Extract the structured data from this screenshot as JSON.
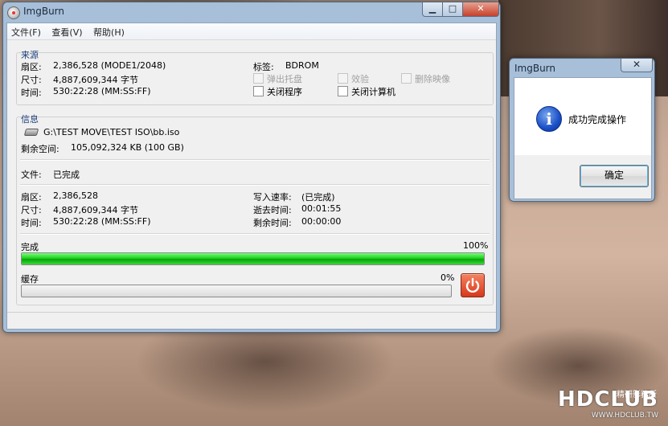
{
  "window": {
    "title": "ImgBurn",
    "min_symbol": "▁",
    "max_symbol": "□",
    "close_symbol": "✕"
  },
  "menu": {
    "file": "文件(F)",
    "view": "查看(V)",
    "help": "帮助(H)"
  },
  "source": {
    "title": "来源",
    "sectors_label": "扇区:",
    "sectors_value": "2,386,528 (MODE1/2048)",
    "size_label": "尺寸:",
    "size_value": "4,887,609,344 字节",
    "time_label": "时间:",
    "time_value": "530:22:28 (MM:SS:FF)",
    "tag_label": "标签:",
    "tag_value": "BDROM",
    "eject_tray": "弹出托盘",
    "verify": "效验",
    "delete_image": "删除映像",
    "close_program": "关闭程序",
    "shutdown_computer": "关闭计算机"
  },
  "info": {
    "title": "信息",
    "path": "G:\\TEST MOVE\\TEST ISO\\bb.iso",
    "free_space_label": "剩余空间:",
    "free_space_value": "105,092,324 KB  (100 GB)",
    "file_label": "文件:",
    "file_value": "已完成",
    "sectors_label": "扇区:",
    "sectors_value": "2,386,528",
    "size_label": "尺寸:",
    "size_value": "4,887,609,344 字节",
    "time_label": "时间:",
    "time_value": "530:22:28 (MM:SS:FF)",
    "write_speed_label": "写入速率:",
    "write_speed_value": "(已完成)",
    "elapsed_label": "逝去时间:",
    "elapsed_value": "00:01:55",
    "remaining_label": "剩余时间:",
    "remaining_value": "00:00:00",
    "complete_label": "完成",
    "complete_percent": "100%",
    "complete_fraction": 1.0,
    "buffer_label": "缓存",
    "buffer_percent": "0%",
    "buffer_fraction": 0.0
  },
  "dialog": {
    "title": "ImgBurn",
    "close_symbol": "✕",
    "message": "成功完成操作",
    "ok": "确定",
    "info_symbol": "i"
  },
  "watermark": {
    "logo": "HDCLUB",
    "url": "WWW.HDCLUB.TW",
    "cn": "精研影務所"
  },
  "colors": {
    "progress": "#1bd31b",
    "accent": "#1d3f7a",
    "power": "#d6381b"
  },
  "icons": {
    "drive": "drive-icon",
    "power": "power-icon",
    "info": "info-icon",
    "app": "app-icon"
  }
}
